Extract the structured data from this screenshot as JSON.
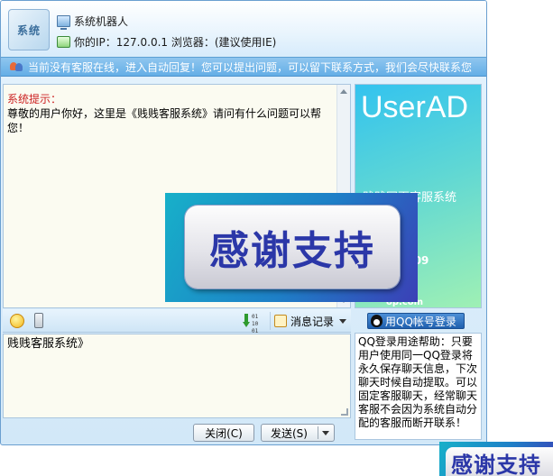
{
  "header": {
    "avatar_label": "系统",
    "robot_name": "系统机器人",
    "ip_line": "你的IP：127.0.0.1 浏览器：(建议使用IE)"
  },
  "notice": {
    "text": "当前没有客服在线，进入自动回复！您可以提出问题，可以留下联系方式，我们会尽快联系您"
  },
  "chat": {
    "system_label": "系统提示：",
    "message": "尊敬的用户你好，这里是《贱贱客服系统》请问有什么问题可以帮您！"
  },
  "ad": {
    "title": "UserAD",
    "subtitle": "贱贱网页客服系统",
    "number": "4409",
    "url": "op.com"
  },
  "toolbar": {
    "transfer_bits": "01 10 01",
    "history_label": "消息记录"
  },
  "input": {
    "value": "贱贱客服系统》"
  },
  "qq": {
    "login_label": "用QQ帐号登录",
    "help_text": "QQ登录用途帮助：只要用户使用同一QQ登录将永久保存聊天信息，下次聊天时候自动提取。可以固定客服聊天，经常聊天客服不会因为系统自动分配的客服而断开联系！"
  },
  "buttons": {
    "close_label": "关闭(C)",
    "send_label": "发送(S)"
  },
  "banner": {
    "text": "感谢支持",
    "mini_text": "感谢支持"
  },
  "colors": {
    "notice_bg": "#64aee6",
    "system_label": "#cc2222",
    "qq_button": "#1f5fae",
    "banner_text": "#2b37a8"
  }
}
